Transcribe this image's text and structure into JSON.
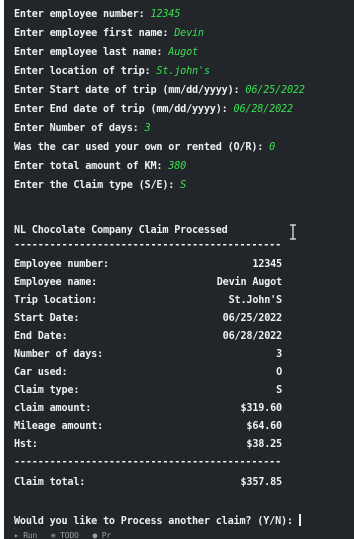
{
  "prompts": [
    {
      "label": "Enter employee number: ",
      "value": "12345"
    },
    {
      "label": "Enter employee first name: ",
      "value": "Devin"
    },
    {
      "label": "Enter employee last name: ",
      "value": "Augot"
    },
    {
      "label": "Enter location of trip: ",
      "value": "St.john's"
    },
    {
      "label": "Enter Start date of trip (mm/dd/yyyy): ",
      "value": "06/25/2022"
    },
    {
      "label": "Enter End date of trip (mm/dd/yyyy): ",
      "value": "06/28/2022"
    },
    {
      "label": "Enter Number of days: ",
      "value": "3"
    },
    {
      "label": "Was the car used your own or rented (O/R): ",
      "value": "0"
    },
    {
      "label": "Enter total amount of KM: ",
      "value": "380"
    },
    {
      "label": "Enter the Claim type (S/E): ",
      "value": "S"
    }
  ],
  "report": {
    "title": "NL Chocolate Company Claim Processed",
    "divider": "----------------------------------------------",
    "rows": [
      {
        "label": "Employee number:",
        "value": "12345"
      },
      {
        "label": "Employee name:",
        "value": "Devin Augot"
      },
      {
        "label": "Trip location:",
        "value": "St.John'S"
      },
      {
        "label": "Start Date:",
        "value": "06/25/2022"
      },
      {
        "label": "End Date:",
        "value": "06/28/2022"
      },
      {
        "label": "Number of days:",
        "value": "3"
      },
      {
        "label": "Car used:",
        "value": "O"
      },
      {
        "label": "Claim type:",
        "value": "S"
      },
      {
        "label": "claim amount:",
        "value": "$319.60"
      },
      {
        "label": "Mileage amount:",
        "value": "$64.60"
      },
      {
        "label": "Hst:",
        "value": "$38.25"
      }
    ],
    "total": {
      "label": "Claim total:",
      "value": "$357.85"
    }
  },
  "final_prompt": "Would you like to Process another claim? (Y/N): ",
  "status_bar": "▸ Run   ≡ TODO   ● Pr",
  "colors": {
    "background": "#22252a",
    "text": "#eef0f2",
    "input": "#36e04f"
  }
}
